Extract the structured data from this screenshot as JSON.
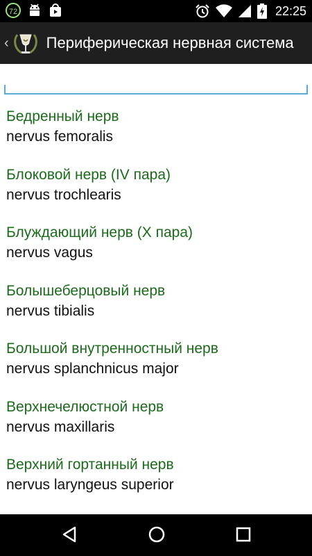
{
  "status_bar": {
    "left_icons": [
      "notification-72-icon",
      "android-debug-icon",
      "store-bag-icon"
    ],
    "notification_badge": "72",
    "right_icons": [
      "alarm-icon",
      "wifi-icon",
      "signal-icon",
      "battery-icon"
    ],
    "time": "22:25"
  },
  "action_bar": {
    "title": "Периферическая нервная система",
    "up_icon": "chevron-left-icon",
    "logo_icon": "chalice-laurel-icon"
  },
  "search": {
    "value": "",
    "placeholder": ""
  },
  "items": [
    {
      "ru": "Бедренный нерв",
      "lat": "nervus femoralis"
    },
    {
      "ru": "Блоковой нерв (IV пара)",
      "lat": "nervus trochlearis"
    },
    {
      "ru": "Блуждающий нерв (X пара)",
      "lat": "nervus vagus"
    },
    {
      "ru": "Болышеберцовый нерв",
      "lat": "nervus tibialis"
    },
    {
      "ru": "Большой внутренностный нерв",
      "lat": "nervus splanchnicus major"
    },
    {
      "ru": "Верхнечелюстной нерв",
      "lat": "nervus maxillaris"
    },
    {
      "ru": "Верхний гортанный нерв",
      "lat": "nervus laryngeus superior"
    }
  ],
  "nav_bar": {
    "buttons": [
      "back-icon",
      "home-icon",
      "recents-icon"
    ]
  },
  "colors": {
    "title_green": "#1a6b1a",
    "focus_blue": "#5aa9d6",
    "action_bar_bg": "#1f1f1f"
  }
}
